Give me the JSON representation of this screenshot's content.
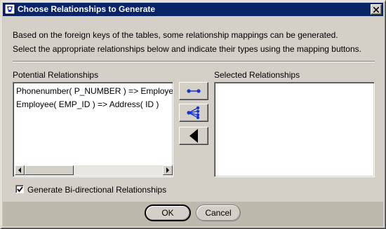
{
  "window": {
    "title": "Choose Relationships to Generate"
  },
  "description": {
    "line1": "Based on the foreign keys of the tables, some relationship mappings can be generated.",
    "line2": "Select the appropriate relationships below and indicate their types using the mapping buttons."
  },
  "potential": {
    "label": "Potential Relationships",
    "items": [
      "Phonenumber( P_NUMBER ) => Employee( EMP_ID )",
      "Employee( EMP_ID ) => Address( ID )"
    ]
  },
  "selected": {
    "label": "Selected Relationships",
    "items": []
  },
  "mapping_buttons": {
    "one_to_one_icon": "one-to-one-icon",
    "one_to_many_icon": "one-to-many-icon",
    "remove_icon": "left-arrow-icon"
  },
  "options": {
    "bidirectional_label": "Generate Bi-directional Relationships",
    "bidirectional_checked": true
  },
  "buttons": {
    "ok": "OK",
    "cancel": "Cancel"
  },
  "colors": {
    "titlebar": "#0a246a",
    "dialog_bg": "#d4d0c8",
    "icon_blue": "#1a33d6"
  }
}
